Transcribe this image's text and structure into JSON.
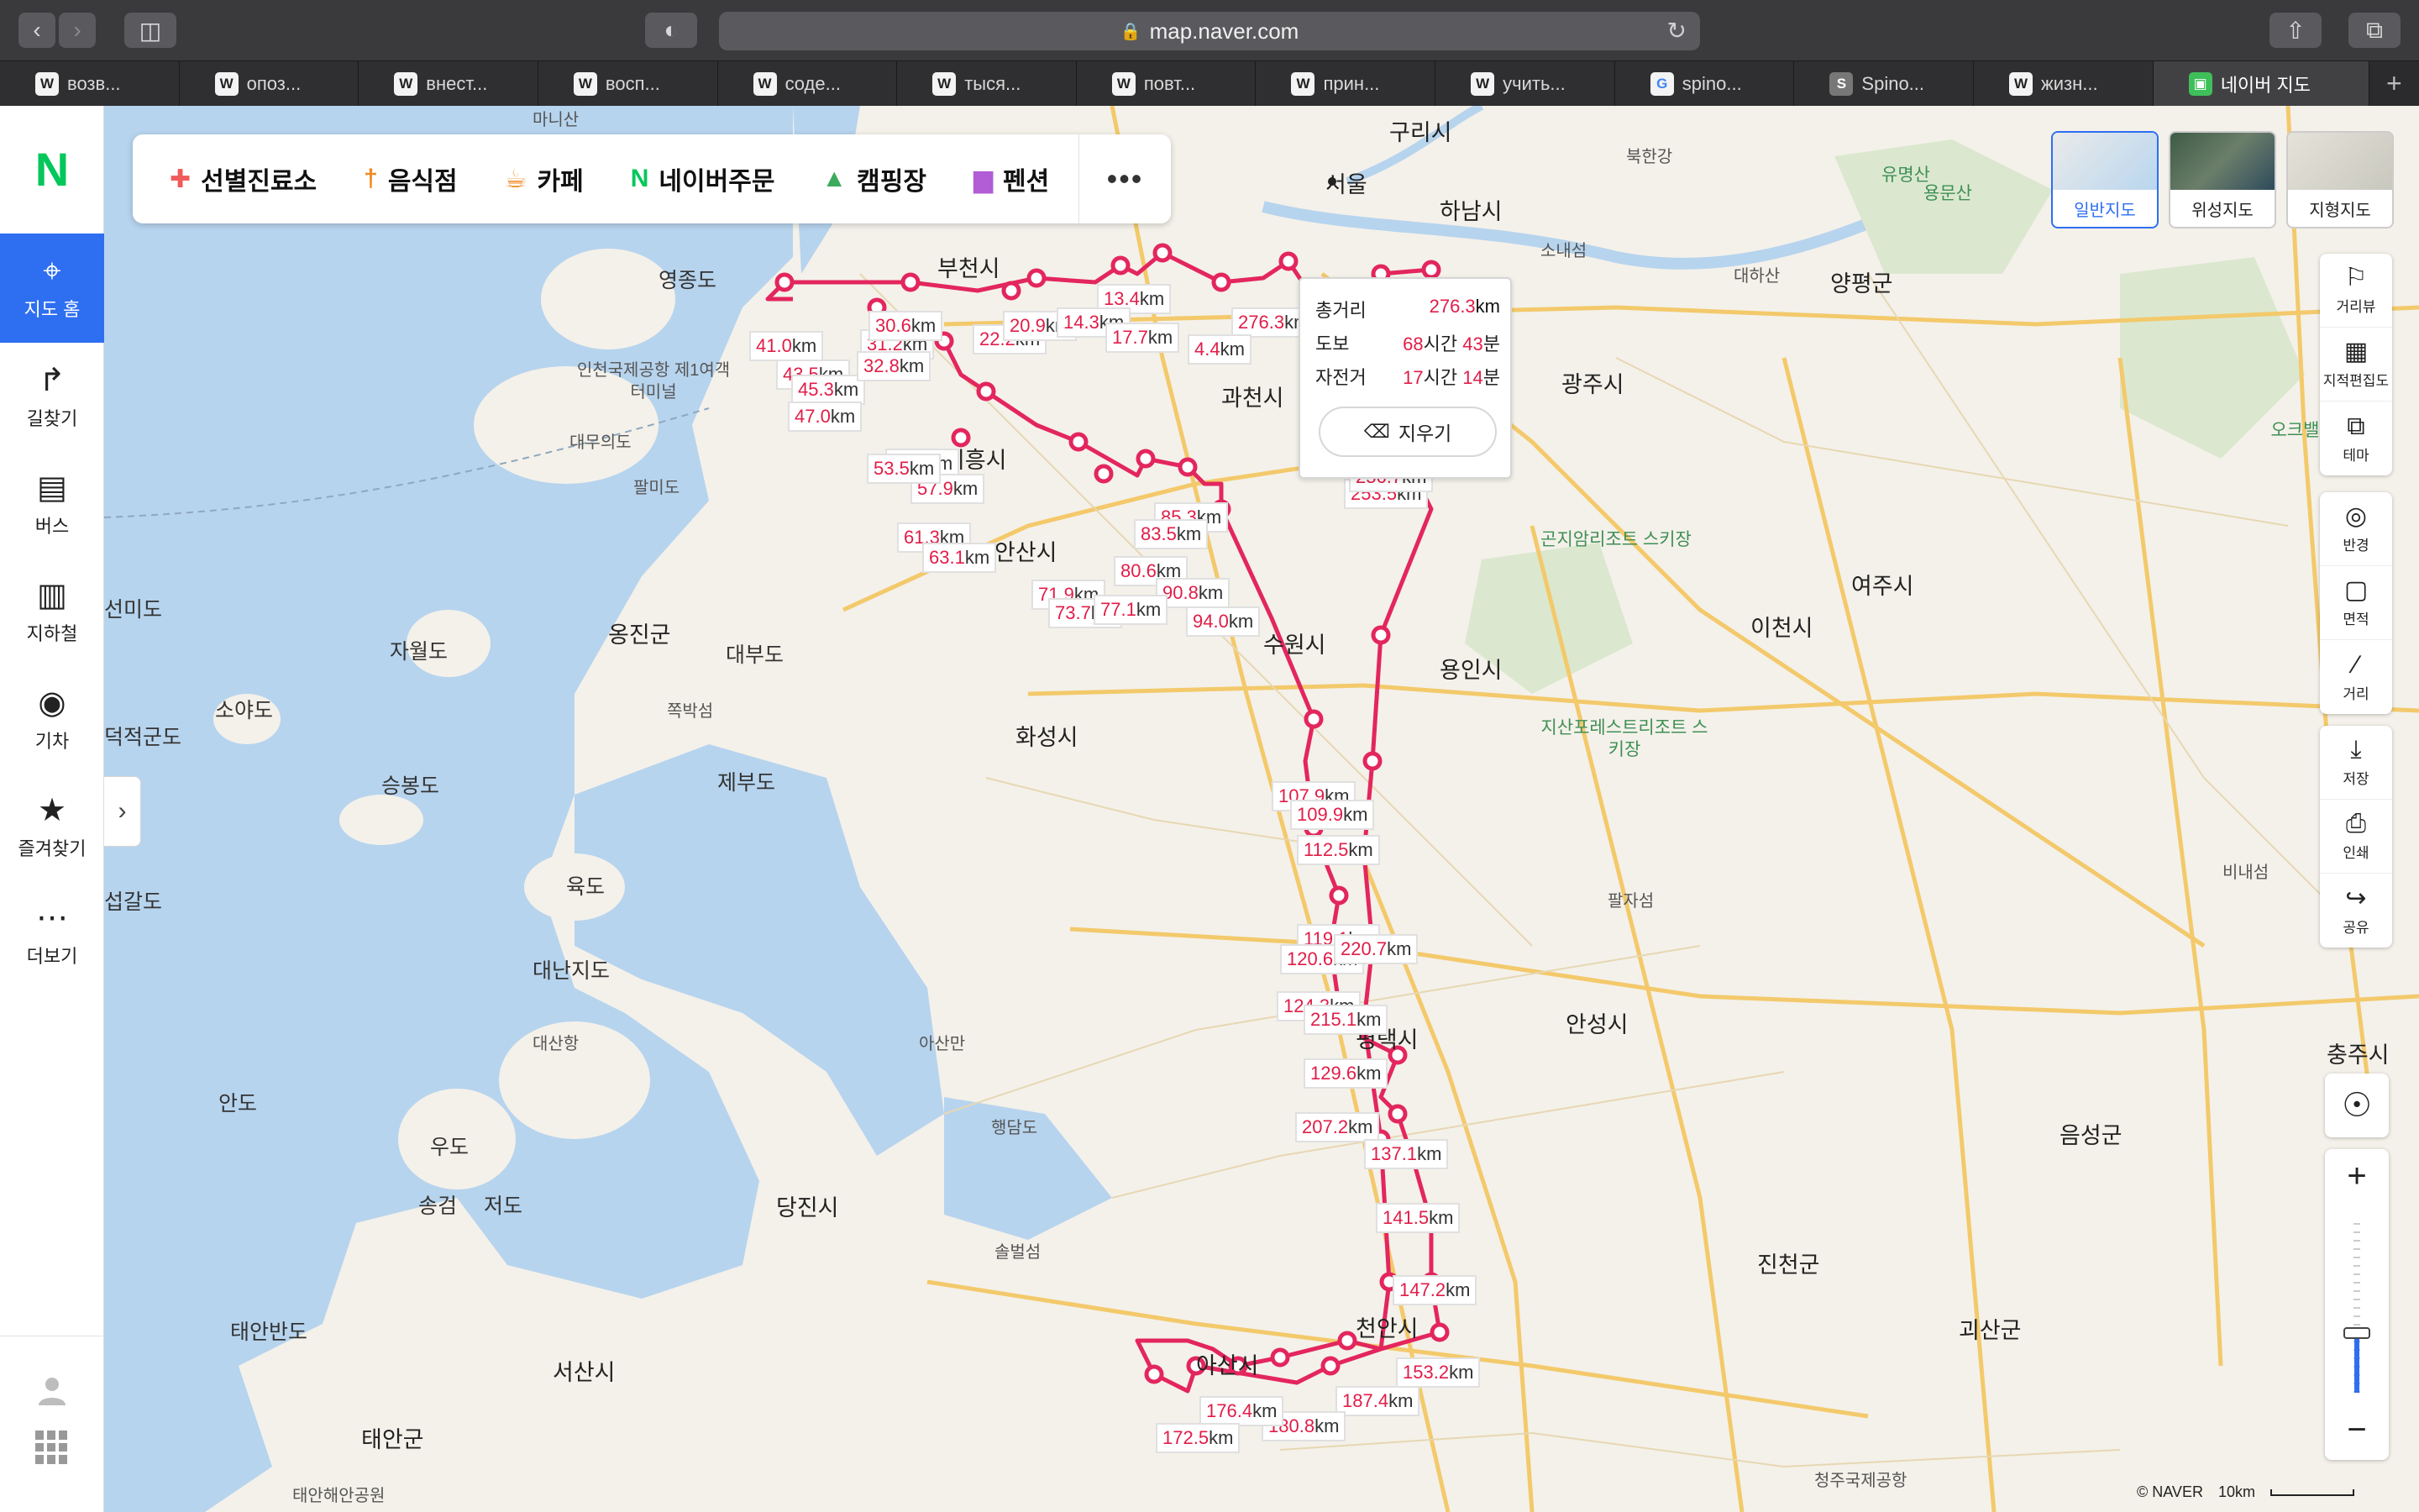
{
  "browser": {
    "url": "map.naver.com",
    "tabs": [
      {
        "label": "возв...",
        "icon": "wiki-icon"
      },
      {
        "label": "опоз...",
        "icon": "wiki-icon"
      },
      {
        "label": "внест...",
        "icon": "wiki-icon"
      },
      {
        "label": "восп...",
        "icon": "wiki-icon"
      },
      {
        "label": "соде...",
        "icon": "wiki-icon"
      },
      {
        "label": "тыся...",
        "icon": "wiki-icon"
      },
      {
        "label": "повт...",
        "icon": "wiki-icon"
      },
      {
        "label": "прин...",
        "icon": "wiki-icon"
      },
      {
        "label": "учить...",
        "icon": "wiki-icon"
      },
      {
        "label": "spino...",
        "icon": "google-icon"
      },
      {
        "label": "Spino...",
        "icon": "s-icon"
      },
      {
        "label": "жизн...",
        "icon": "wiki-icon"
      },
      {
        "label": "네이버 지도",
        "icon": "naver-map-icon",
        "active": true
      }
    ]
  },
  "sidebar": {
    "logo": "N",
    "items": [
      {
        "label": "지도 홈",
        "icon": "map-pin-icon",
        "active": true
      },
      {
        "label": "길찾기",
        "icon": "directions-icon"
      },
      {
        "label": "버스",
        "icon": "bus-icon"
      },
      {
        "label": "지하철",
        "icon": "subway-icon"
      },
      {
        "label": "기차",
        "icon": "train-icon"
      },
      {
        "label": "즐겨찾기",
        "icon": "star-icon"
      },
      {
        "label": "더보기",
        "icon": "more-icon"
      }
    ]
  },
  "categories": [
    {
      "label": "선별진료소",
      "icon": "clinic-icon",
      "color": "#f05a5a"
    },
    {
      "label": "음식점",
      "icon": "fork-icon",
      "color": "#f08a24"
    },
    {
      "label": "카페",
      "icon": "cafe-icon",
      "color": "#f08a24"
    },
    {
      "label": "네이버주문",
      "icon": "naver-n-icon",
      "color": "#03c75a"
    },
    {
      "label": "캠핑장",
      "icon": "tent-icon",
      "color": "#3caa5c"
    },
    {
      "label": "펜션",
      "icon": "bed-icon",
      "color": "#b25cd6"
    }
  ],
  "map_types": [
    {
      "label": "일반지도",
      "selected": true
    },
    {
      "label": "위성지도",
      "selected": false
    },
    {
      "label": "지형지도",
      "selected": false
    }
  ],
  "tools_group1": [
    {
      "label": "거리뷰",
      "icon": "streetview-icon"
    },
    {
      "label": "지적편집도",
      "icon": "cadastral-icon"
    },
    {
      "label": "테마",
      "icon": "theme-icon"
    }
  ],
  "tools_group2": [
    {
      "label": "반경",
      "icon": "radius-icon"
    },
    {
      "label": "면적",
      "icon": "area-icon"
    },
    {
      "label": "거리",
      "icon": "ruler-icon"
    }
  ],
  "tools_group3": [
    {
      "label": "저장",
      "icon": "download-icon"
    },
    {
      "label": "인쇄",
      "icon": "print-icon"
    },
    {
      "label": "공유",
      "icon": "share-icon"
    }
  ],
  "distance_popup": {
    "total_label": "총거리",
    "total_value": "276.3",
    "total_unit": "km",
    "walk_label": "도보",
    "walk_h": "68",
    "walk_m": "43",
    "bike_label": "자전거",
    "bike_h": "17",
    "bike_m": "14",
    "hour_unit": "시간",
    "min_unit": "분",
    "clear_label": "지우기"
  },
  "attribution": {
    "copyright": "© NAVER",
    "scale": "10km"
  },
  "map_labels": [
    {
      "text": "마니산",
      "cls": "sm"
    },
    {
      "text": "서울",
      "cls": "big"
    },
    {
      "text": "구리시",
      "cls": "big"
    },
    {
      "text": "하남시",
      "cls": "big"
    },
    {
      "text": "부천시",
      "cls": "big"
    },
    {
      "text": "영종도",
      "cls": ""
    },
    {
      "text": "인천국제공항 제1여객터미널",
      "cls": "sm"
    },
    {
      "text": "대무의도",
      "cls": "sm"
    },
    {
      "text": "팔미도",
      "cls": "sm"
    },
    {
      "text": "시흥시",
      "cls": "big"
    },
    {
      "text": "안산시",
      "cls": "big"
    },
    {
      "text": "과천시",
      "cls": "big"
    },
    {
      "text": "광주시",
      "cls": "big"
    },
    {
      "text": "양평군",
      "cls": "big"
    },
    {
      "text": "수원시",
      "cls": "big"
    },
    {
      "text": "용인시",
      "cls": "big"
    },
    {
      "text": "이천시",
      "cls": "big"
    },
    {
      "text": "여주시",
      "cls": "big"
    },
    {
      "text": "화성시",
      "cls": "big"
    },
    {
      "text": "옹진군",
      "cls": "big"
    },
    {
      "text": "자월도",
      "cls": ""
    },
    {
      "text": "대부도",
      "cls": ""
    },
    {
      "text": "선미도",
      "cls": ""
    },
    {
      "text": "덕적군도",
      "cls": ""
    },
    {
      "text": "소야도",
      "cls": ""
    },
    {
      "text": "승봉도",
      "cls": ""
    },
    {
      "text": "제부도",
      "cls": ""
    },
    {
      "text": "쪽박섬",
      "cls": "sm"
    },
    {
      "text": "육도",
      "cls": ""
    },
    {
      "text": "대난지도",
      "cls": ""
    },
    {
      "text": "대산항",
      "cls": "sm"
    },
    {
      "text": "아산만",
      "cls": "sm"
    },
    {
      "text": "안성시",
      "cls": "big"
    },
    {
      "text": "팔자섬",
      "cls": "sm"
    },
    {
      "text": "평택시",
      "cls": "big"
    },
    {
      "text": "안도",
      "cls": ""
    },
    {
      "text": "우도",
      "cls": ""
    },
    {
      "text": "송검",
      "cls": ""
    },
    {
      "text": "저도",
      "cls": ""
    },
    {
      "text": "행담도",
      "cls": "sm"
    },
    {
      "text": "당진시",
      "cls": "big"
    },
    {
      "text": "태안반도",
      "cls": ""
    },
    {
      "text": "서산시",
      "cls": "big"
    },
    {
      "text": "태안군",
      "cls": "big"
    },
    {
      "text": "아산시",
      "cls": "big"
    },
    {
      "text": "천안시",
      "cls": "big"
    },
    {
      "text": "음성군",
      "cls": "big"
    },
    {
      "text": "진천군",
      "cls": "big"
    },
    {
      "text": "괴산군",
      "cls": "big"
    },
    {
      "text": "충주시",
      "cls": "big"
    },
    {
      "text": "솔벌섬",
      "cls": "sm"
    },
    {
      "text": "곤지암리조트 스키장",
      "cls": "green"
    },
    {
      "text": "지산포레스트리조트 스키장",
      "cls": "green"
    },
    {
      "text": "오크밸리 스키장",
      "cls": "green"
    },
    {
      "text": "유명산",
      "cls": "green"
    },
    {
      "text": "용문산",
      "cls": "green"
    },
    {
      "text": "대하산",
      "cls": "sm"
    },
    {
      "text": "소내섬",
      "cls": "sm"
    },
    {
      "text": "북한강",
      "cls": "sm"
    },
    {
      "text": "비내섬",
      "cls": "sm"
    },
    {
      "text": "태안해안공원",
      "cls": "sm"
    },
    {
      "text": "청주국제공항",
      "cls": "sm"
    },
    {
      "text": "섭갈도",
      "cls": ""
    }
  ],
  "km_labels": [
    "41.0",
    "43.5",
    "45.3",
    "47.0",
    "31.2",
    "32.8",
    "30.6",
    "22.2",
    "20.9",
    "13.4",
    "14.3",
    "17.7",
    "276.3",
    "4.4",
    "55.5",
    "57.9",
    "53.5",
    "61.3",
    "63.1",
    "85.3",
    "83.5",
    "80.6",
    "90.8",
    "71.9",
    "73.7",
    "77.1",
    "94.0",
    "107.9",
    "109.9",
    "112.5",
    "119.1",
    "120.6",
    "220.7",
    "124.3",
    "215.1",
    "129.6",
    "207.2",
    "137.1",
    "141.5",
    "147.2",
    "153.2",
    "187.4",
    "180.8",
    "176.4",
    "172.5",
    "253.5",
    "256.7"
  ]
}
